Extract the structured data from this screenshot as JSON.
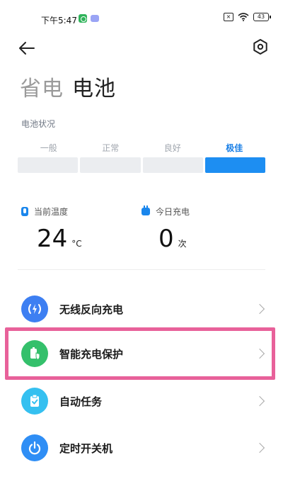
{
  "status_bar": {
    "time": "下午5:47",
    "battery": "43"
  },
  "header": {
    "title_secondary": "省电",
    "title_primary": "电池"
  },
  "battery_status": {
    "label": "电池状况",
    "levels": [
      "一般",
      "正常",
      "良好",
      "极佳"
    ],
    "active_level_index": 3
  },
  "stats": {
    "temperature": {
      "label": "当前温度",
      "value": "24",
      "unit": "°C"
    },
    "charges_today": {
      "label": "今日充电",
      "value": "0",
      "unit": "次"
    }
  },
  "menu": {
    "items": [
      {
        "label": "无线反向充电",
        "icon": "wireless-charge-icon",
        "color": "#3d7ff2"
      },
      {
        "label": "智能充电保护",
        "icon": "battery-shield-icon",
        "color": "#34c06b"
      },
      {
        "label": "自动任务",
        "icon": "clipboard-check-icon",
        "color": "#35c0f0"
      },
      {
        "label": "定时开关机",
        "icon": "power-icon",
        "color": "#2f8ef5"
      }
    ]
  },
  "colors": {
    "accent": "#1d8ef2",
    "highlight": "#e8619a"
  }
}
